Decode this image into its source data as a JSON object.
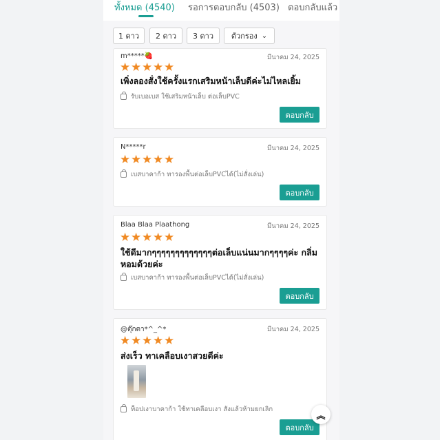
{
  "tabs": [
    {
      "label": "ทั้งหมด (4540)",
      "active": true
    },
    {
      "label": "รอการตอบกลับ (4503)",
      "active": false
    },
    {
      "label": "ตอบกลับแล้ว",
      "active": false
    }
  ],
  "filters": {
    "chips": [
      "1 ดาว",
      "2 ดาว",
      "3 ดาว"
    ],
    "dropdown_label": "ตัวกรอง"
  },
  "reviews": [
    {
      "user": "m*****🍓",
      "date": "มีนาคม 24, 2025",
      "rating": 5,
      "text": "เพิ่งลองสั่งใช้ครั้งแรกเสริมหน้าเล็บดีค่ะไม่ไหลเยิ้ม",
      "variant": "รับเบอเบส ใช้เสริมหน้าเล็บ ต่อเล็บPVC",
      "reply_label": "ตอบกลับ"
    },
    {
      "user": "N*****r",
      "date": "มีนาคม 24, 2025",
      "rating": 5,
      "text": "",
      "variant": "เบสบาคาก้า ทารองพื้นต่อเล็บPVCได้(ไม่สั่งเล่น)",
      "reply_label": "ตอบกลับ"
    },
    {
      "user": "Blaa Blaa Plaathong",
      "date": "มีนาคม 24, 2025",
      "rating": 5,
      "text": "ใช้ดีมากๆๆๆๆๆๆๆๆๆๆๆๆๆต่อเล็บแน่นมากๆๆๆๆค่ะ กลิ่มหอมด้วยค่ะ",
      "variant": "เบสบาคาก้า ทารองพื้นต่อเล็บPVCได้(ไม่สั่งเล่น)",
      "reply_label": "ตอบกลับ"
    },
    {
      "user": "@ตุ๊กตา*^_^*",
      "date": "มีนาคม 24, 2025",
      "rating": 5,
      "text": "ส่งเร็ว ทาเคลือบเงาสวยดีค่ะ",
      "variant": "ท็อปเงาบาคาก้า ใช้ทาเคลือบเงา สังแล้วห้ามยกเลิก",
      "reply_label": "ตอบกลับ"
    }
  ],
  "icons": {
    "dropdown": "chevron-down-icon",
    "variant": "shopping-bag-icon",
    "scroll_top": "double-chevron-up-icon"
  },
  "colors": {
    "accent": "#1a9e93",
    "star": "#f08a24"
  }
}
